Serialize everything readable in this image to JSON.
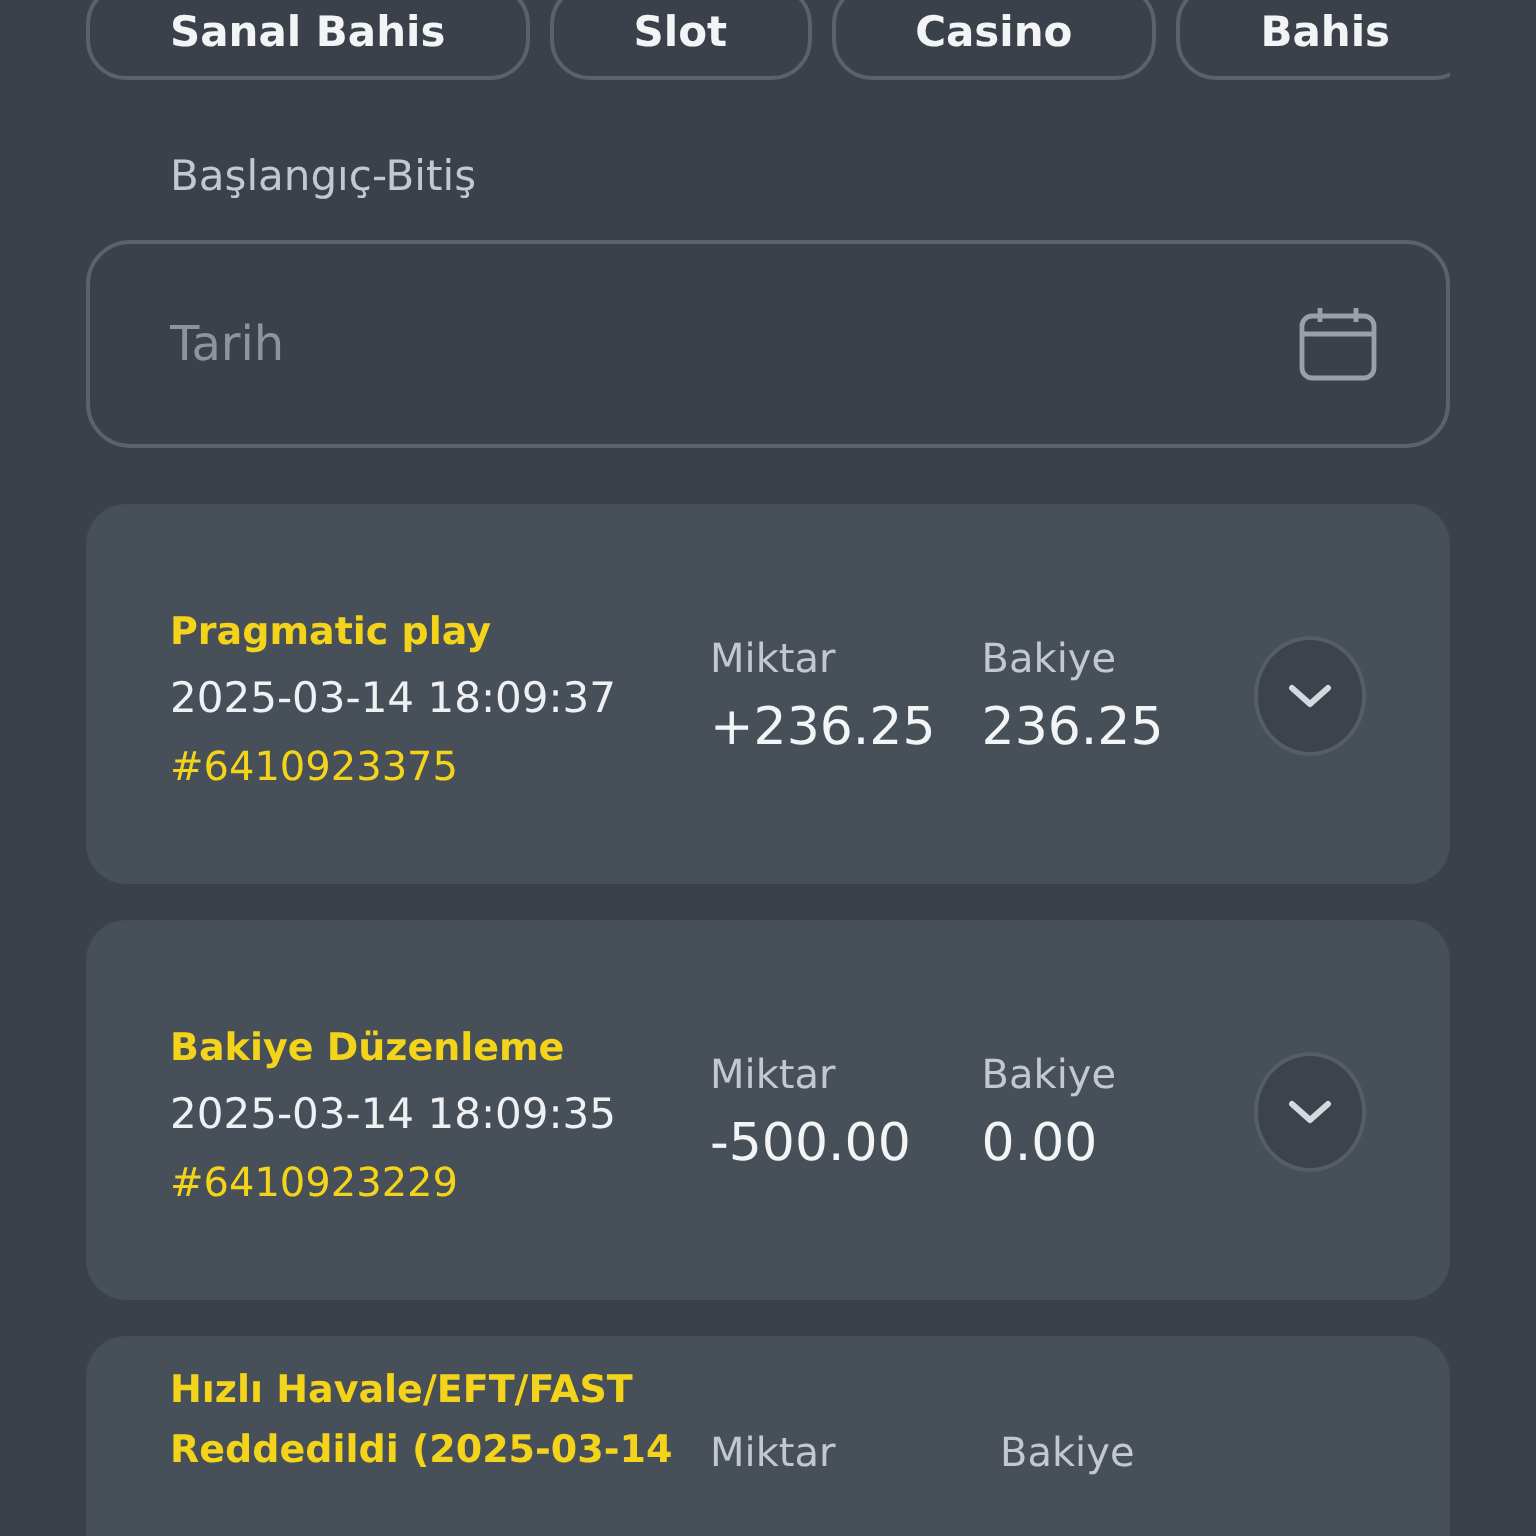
{
  "tabs": [
    {
      "label": "Sanal Bahis"
    },
    {
      "label": "Slot"
    },
    {
      "label": "Casino"
    },
    {
      "label": "Bahis"
    }
  ],
  "date_filter": {
    "label": "Başlangıç-Bitiş",
    "placeholder": "Tarih"
  },
  "transactions": [
    {
      "title": "Pragmatic play",
      "date": "2025-03-14 18:09:37",
      "id": "#6410923375",
      "amount_label": "Miktar",
      "amount": "+236.25",
      "balance_label": "Bakiye",
      "balance": "236.25"
    },
    {
      "title": "Bakiye Düzenleme",
      "date": "2025-03-14 18:09:35",
      "id": "#6410923229",
      "amount_label": "Miktar",
      "amount": "-500.00",
      "balance_label": "Bakiye",
      "balance": "0.00"
    },
    {
      "title": "Hızlı Havale/EFT/FAST Reddedildi (2025-03-14",
      "amount_label": "Miktar",
      "balance_label": "Bakiye"
    }
  ]
}
